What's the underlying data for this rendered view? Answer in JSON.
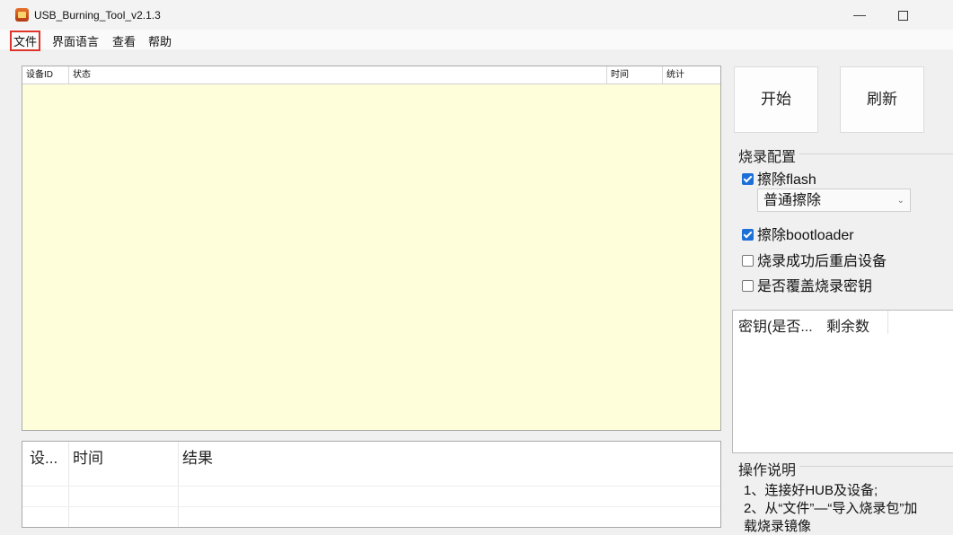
{
  "window": {
    "title": "USB_Burning_Tool_v2.1.3",
    "minimize_glyph": "—"
  },
  "menu": {
    "file": "文件",
    "language": "界面语言",
    "view": "查看",
    "help": "帮助"
  },
  "device_table": {
    "columns": [
      "设备ID",
      "状态",
      "时间",
      "统计"
    ],
    "background": "#fffedb"
  },
  "log_table": {
    "columns": [
      "设...",
      "时间",
      "结果"
    ]
  },
  "buttons": {
    "start": "开始",
    "refresh": "刷新"
  },
  "burn_config": {
    "title": "烧录配置",
    "erase_flash": {
      "label": "擦除flash",
      "checked": true
    },
    "erase_mode": {
      "selected": "普通擦除"
    },
    "erase_bootloader": {
      "label": "擦除bootloader",
      "checked": true
    },
    "reboot_after": {
      "label": "烧录成功后重启设备",
      "checked": false
    },
    "overwrite_key": {
      "label": "是否覆盖烧录密钥",
      "checked": false
    }
  },
  "key_table": {
    "columns": [
      "密钥(是否...",
      "剩余数"
    ]
  },
  "instructions": {
    "title": "操作说明",
    "lines": [
      "1、连接好HUB及设备;",
      "2、从“文件”—“导入烧录包”加",
      "载烧录镜像"
    ]
  },
  "colors": {
    "checkbox_checked": "#1d6fd8",
    "highlight_box": "#e0342a"
  }
}
